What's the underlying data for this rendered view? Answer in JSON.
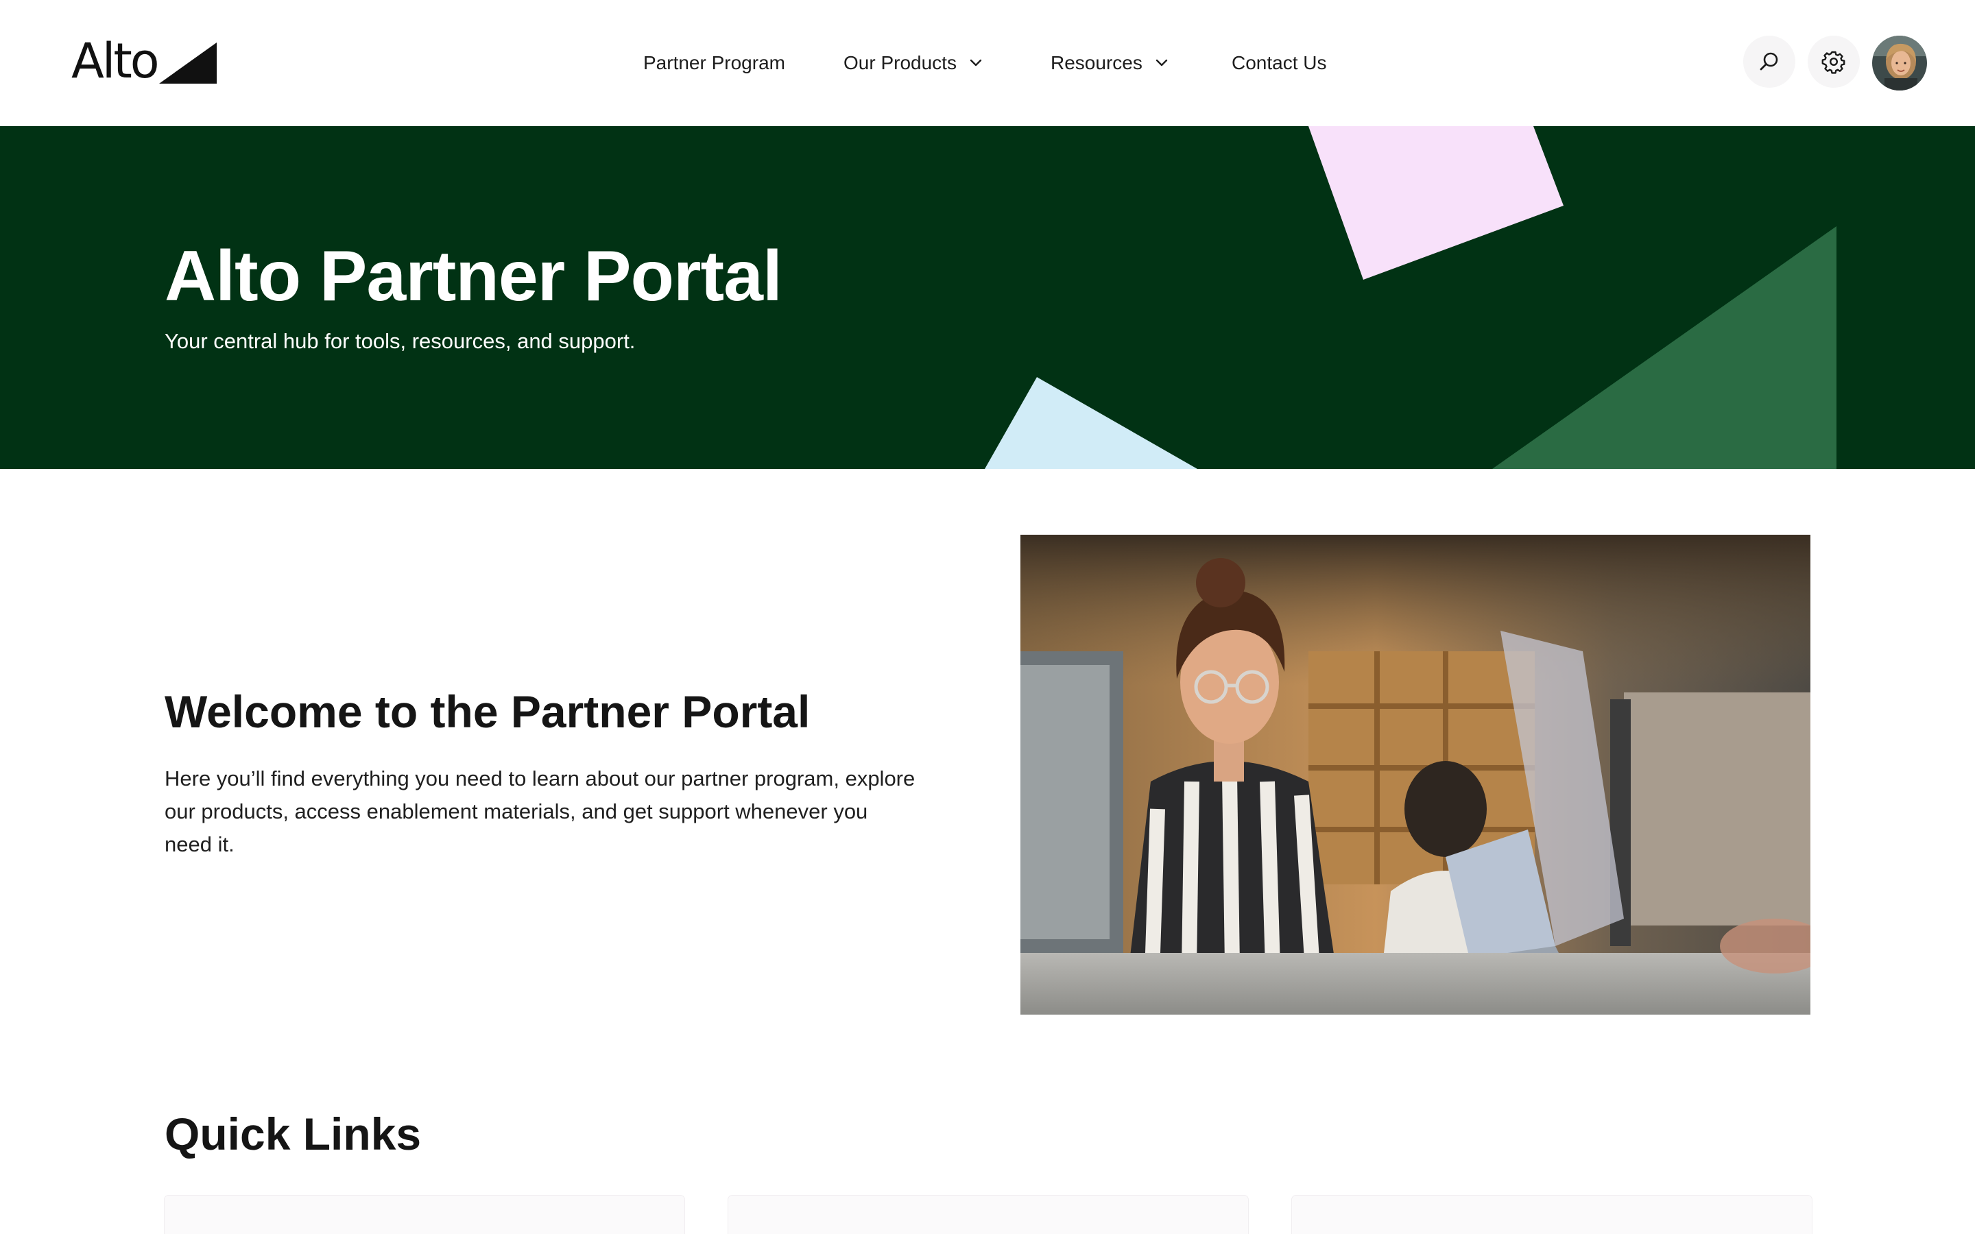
{
  "header": {
    "logo_text": "Alto",
    "nav": [
      {
        "label": "Partner Program",
        "has_dropdown": false
      },
      {
        "label": "Our Products",
        "has_dropdown": true
      },
      {
        "label": "Resources",
        "has_dropdown": true
      },
      {
        "label": "Contact Us",
        "has_dropdown": false
      }
    ],
    "icons": [
      "search-icon",
      "gear-icon",
      "user-avatar"
    ]
  },
  "hero": {
    "title": "Alto Partner Portal",
    "subtitle": "Your central hub for tools, resources, and support.",
    "colors": {
      "background": "#013214",
      "pink": "#f8e1fa",
      "light_blue": "#d1ecf7",
      "green": "#2a6b43"
    }
  },
  "welcome": {
    "title": "Welcome to the Partner Portal",
    "body": "Here you’ll find everything you need to learn about our partner program, explore our products, access enablement materials, and get support whenever you need it."
  },
  "quick_links": {
    "title": "Quick Links",
    "cards": 3
  }
}
